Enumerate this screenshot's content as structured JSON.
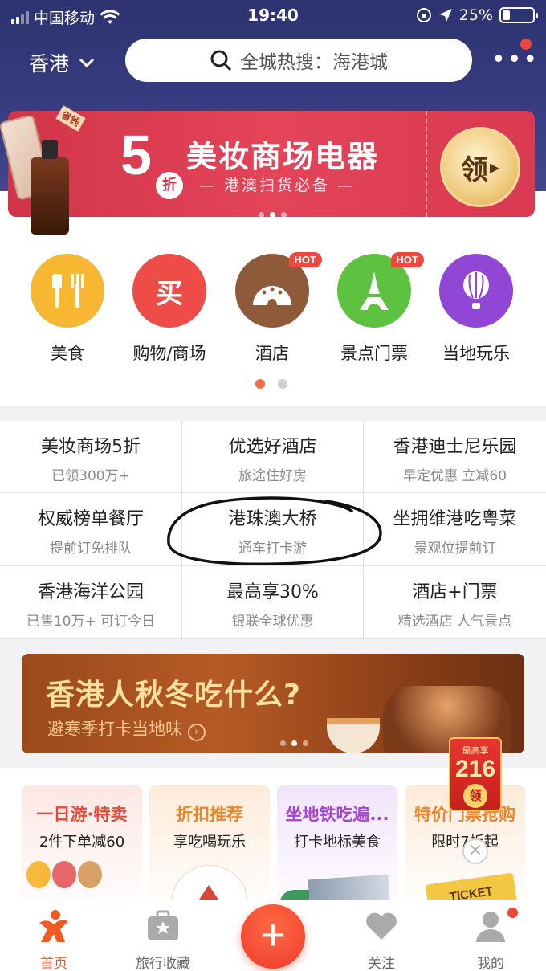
{
  "status_bar": {
    "carrier": "中国移动",
    "time": "19:40",
    "battery": "25%",
    "battery_level": 0.25
  },
  "header": {
    "city": "香港",
    "search_placeholder": "全城热搜：海港城"
  },
  "banner": {
    "discount_number": "5",
    "discount_unit": "折",
    "title": "美妆商场电器",
    "subtitle": "港澳扫货必备",
    "claim_label": "领",
    "badge": "省钱",
    "current_slide": 2,
    "slide_count": 3
  },
  "categories": [
    {
      "label": "美食",
      "color": "#f7b733",
      "icon": "fork-knife-icon",
      "hot": ""
    },
    {
      "label": "购物/商场",
      "color": "#ef4b47",
      "icon": "shopping-icon",
      "glyph": "买",
      "hot": ""
    },
    {
      "label": "酒店",
      "color": "#8e5a3a",
      "icon": "hotel-icon",
      "hot": "HOT"
    },
    {
      "label": "景点门票",
      "color": "#5cc23f",
      "icon": "eiffel-tower-icon",
      "hot": "HOT"
    },
    {
      "label": "当地玩乐",
      "color": "#9146d6",
      "icon": "balloon-icon",
      "hot": ""
    }
  ],
  "category_page": {
    "current": 1,
    "count": 2
  },
  "grid": [
    {
      "title": "美妆商场5折",
      "sub": "已领300万+"
    },
    {
      "title": "优选好酒店",
      "sub": "旅途住好房"
    },
    {
      "title": "香港迪士尼乐园",
      "sub": "早定优惠 立减60"
    },
    {
      "title": "权威榜单餐厅",
      "sub": "提前订免排队"
    },
    {
      "title": "港珠澳大桥",
      "sub": "通车打卡游"
    },
    {
      "title": "坐拥维港吃粤菜",
      "sub": "景观位提前订"
    },
    {
      "title": "香港海洋公园",
      "sub": "已售10万+ 可订今日"
    },
    {
      "title": "最高享30%",
      "sub": "银联全球优惠"
    },
    {
      "title": "酒店+门票",
      "sub": "精选酒店 人气景点"
    }
  ],
  "autumn_banner": {
    "title": "香港人秋冬吃什么?",
    "subtitle": "避寒季打卡当地味"
  },
  "promo_cards": [
    {
      "title": "一日游·特卖",
      "sub": "2件下单减60"
    },
    {
      "title": "折扣推荐",
      "sub": "享吃喝玩乐"
    },
    {
      "title": "坐地铁吃遍...",
      "sub": "打卡地标美食"
    },
    {
      "title": "特价门票抢购",
      "sub": "限时7折起"
    }
  ],
  "ticket_label": "TICKET",
  "red_packet": {
    "top": "最高享",
    "amount": "216",
    "action": "领"
  },
  "tabbar": [
    {
      "label": "首页",
      "active": true
    },
    {
      "label": "旅行收藏",
      "active": false
    },
    {
      "label": "关注",
      "active": false
    },
    {
      "label": "我的",
      "active": false
    }
  ]
}
